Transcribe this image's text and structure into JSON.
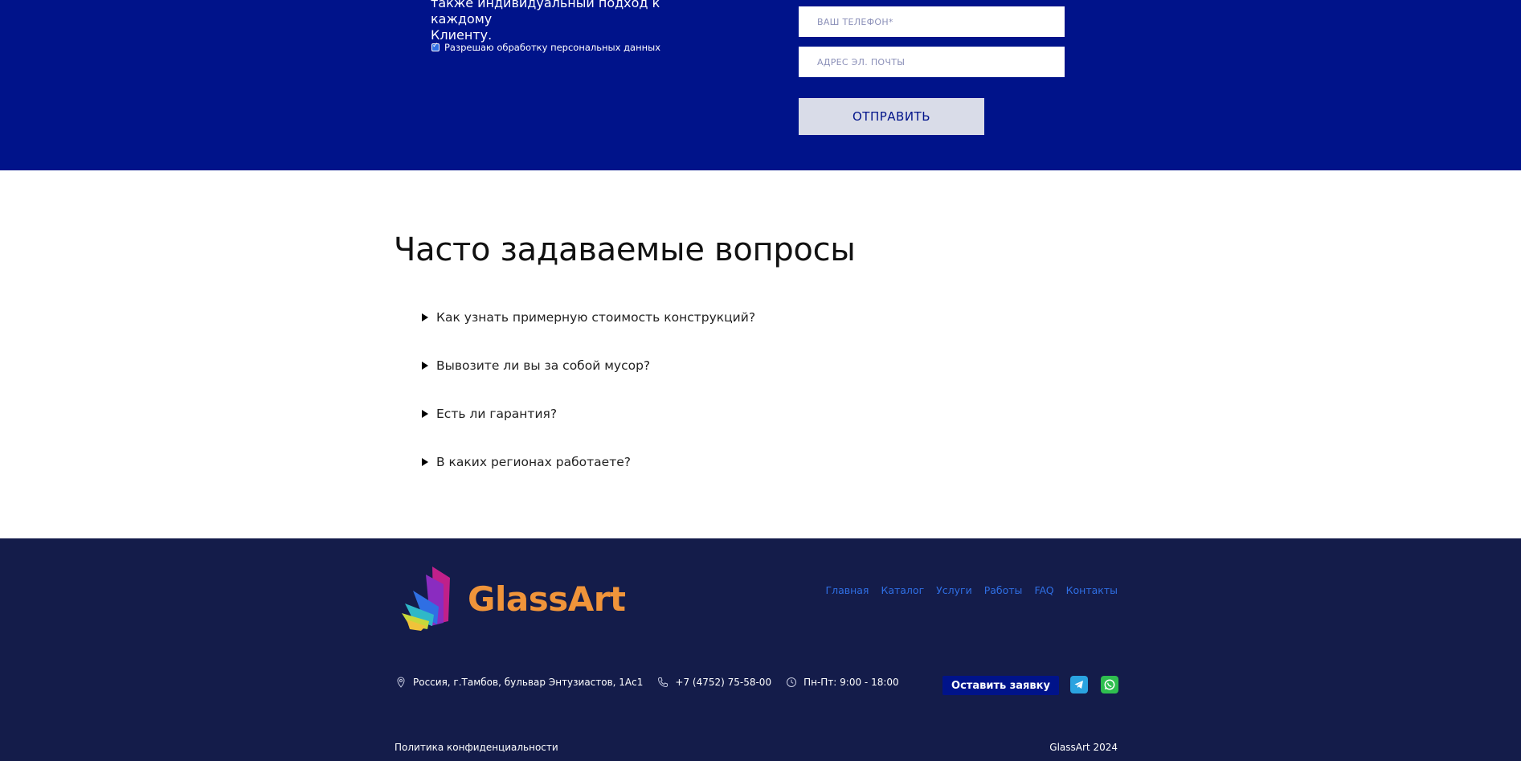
{
  "form": {
    "intro_line1": "также индивидуальный подход к каждому",
    "intro_line2": "Клиенту.",
    "consent_label": "Разрешаю обработку персональных данных",
    "phone_placeholder": "ВАШ ТЕЛЕФОН*",
    "email_placeholder": "АДРЕС ЭЛ. ПОЧТЫ",
    "submit_label": "ОТПРАВИТЬ",
    "consent_checked": true
  },
  "faq": {
    "title": "Часто задаваемые вопросы",
    "items": [
      {
        "question": "Как узнать примерную стоимость конструкций?"
      },
      {
        "question": "Вывозите ли вы за собой мусор?"
      },
      {
        "question": "Есть ли гарантия?"
      },
      {
        "question": "В каких регионах работаете?"
      }
    ]
  },
  "footer": {
    "brand": "GlassArt",
    "nav": [
      "Главная",
      "Каталог",
      "Услуги",
      "Работы",
      "FAQ",
      "Контакты"
    ],
    "address": "Россия, г.Тамбов, бульвар Энтузиастов, 1Ас1",
    "phone": "+7 (4752) 75-58-00",
    "hours": "Пн-Пт: 9:00 - 18:00",
    "cta_label": "Оставить заявку",
    "policy": "Политика конфиденциальности",
    "copyright": "GlassArt 2024"
  },
  "icons": {
    "address": "map-pin-icon",
    "phone": "phone-icon",
    "hours": "clock-icon",
    "telegram": "telegram-icon",
    "whatsapp": "whatsapp-icon",
    "faq_toggle": "triangle-right-icon"
  },
  "colors": {
    "form_band": "#00138a",
    "footer_bg": "#141c4a",
    "brand_orange": "#f0943a",
    "nav_link": "#2f6fe4",
    "telegram": "#2aa3e0",
    "whatsapp": "#2fbe4f"
  }
}
